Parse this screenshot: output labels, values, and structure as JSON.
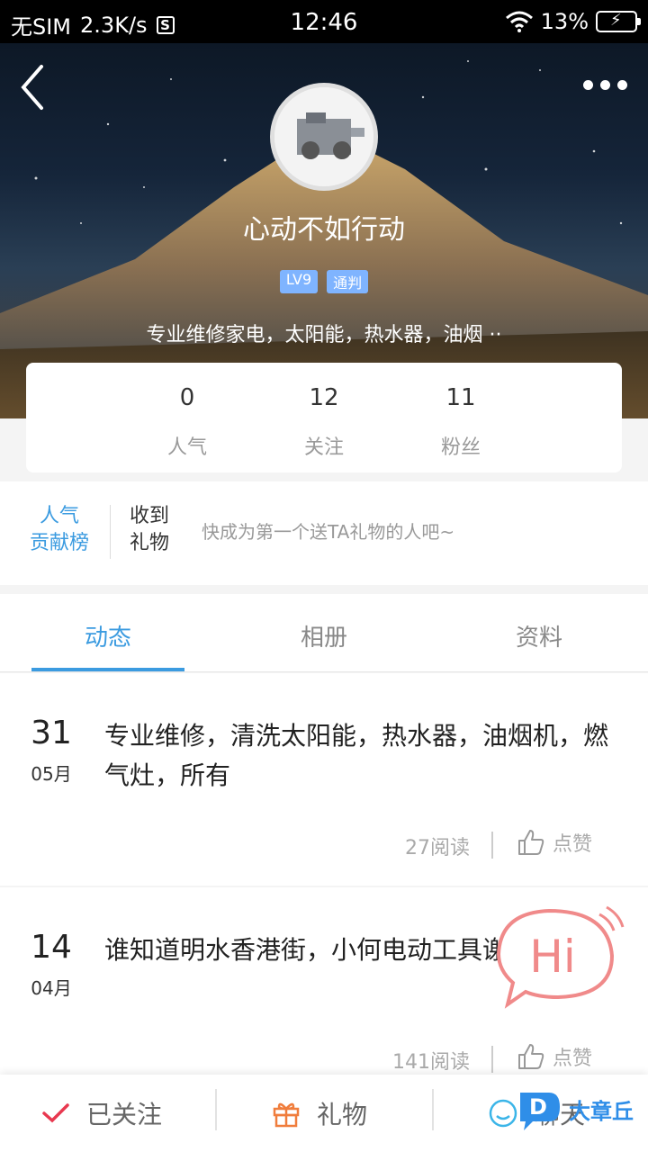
{
  "status_bar": {
    "carrier": "无SIM",
    "speed": "2.3K/s",
    "sim_badge": "S",
    "time": "12:46",
    "battery": "13%"
  },
  "profile": {
    "username": "心动不如行动",
    "level_badge": "LV9",
    "role_badge": "通判",
    "bio": "专业维修家电，太阳能，热水器，油烟 ··"
  },
  "stats": [
    {
      "value": "0",
      "label": "人气"
    },
    {
      "value": "12",
      "label": "关注"
    },
    {
      "value": "11",
      "label": "粉丝"
    }
  ],
  "gifts": {
    "rank_line1": "人气",
    "rank_line2": "贡献榜",
    "received_line1": "收到",
    "received_line2": "礼物",
    "hint": "快成为第一个送TA礼物的人吧~"
  },
  "tabs": [
    {
      "label": "动态",
      "active": true
    },
    {
      "label": "相册",
      "active": false
    },
    {
      "label": "资料",
      "active": false
    }
  ],
  "posts": [
    {
      "day": "31",
      "month": "05月",
      "text": "专业维修，清洗太阳能，热水器，油烟机，燃气灶，所有",
      "reads": "27阅读",
      "like_label": "点赞"
    },
    {
      "day": "14",
      "month": "04月",
      "text": "谁知道明水香港街，小何电动工具谢谢",
      "reads": "141阅读",
      "like_label": "点赞"
    }
  ],
  "hi_bubble": {
    "text": "Hi"
  },
  "bottom_bar": {
    "follow_label": "已关注",
    "gift_label": "礼物",
    "chat_label": "聊天"
  },
  "watermark": {
    "text": "大章丘"
  },
  "colors": {
    "accent": "#3b9be0",
    "follow_check": "#e8384f",
    "gift_icon": "#f07d3c",
    "hi_pink": "#f08a8a"
  }
}
